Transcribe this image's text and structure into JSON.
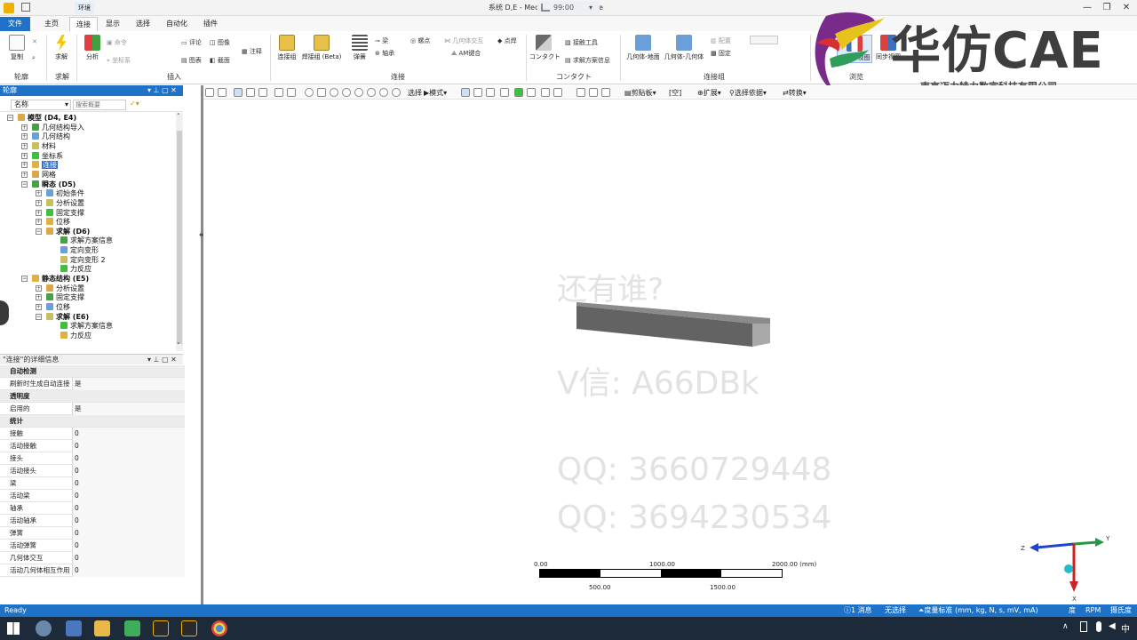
{
  "window": {
    "title": "系统 D,E - Mechanical Enterprise",
    "context_tab": "环境",
    "timer": "99:00",
    "controls": [
      "—",
      "❐",
      "✕"
    ]
  },
  "tabs": [
    "文件",
    "主页",
    "连接",
    "显示",
    "选择",
    "自动化",
    "插件"
  ],
  "ribbon": {
    "groups": {
      "outline": "轮廓",
      "solve": "求解",
      "insert": "插入",
      "connect": "连接",
      "contact": "コンタクト",
      "connect_group": "连接组",
      "browse": "浏览"
    },
    "buttons": {
      "duplicate": "复制",
      "solve": "求解",
      "analysis": "分析",
      "comment": "评论",
      "image": "图像",
      "chart": "图表",
      "section": "截面",
      "annotation": "注释",
      "connection_group": "连接组",
      "weld_group": "焊接组 (Beta)",
      "spring": "弹簧",
      "beam": "梁",
      "bearing": "轴承",
      "bolt": "螺点",
      "geometry_intersect": "几何体交互",
      "spot_weld": "点焊",
      "am_bond": "AM键合",
      "contact": "コンタクト",
      "contact_tool": "接触工具",
      "solution_info": "求解方案信息",
      "body_ground": "几何体-地面",
      "body_body": "几何体-几何体",
      "config": "配置",
      "body_views": "几何体视图",
      "sync_views": "同步视图",
      "command": "命令",
      "coordinate": "坐标系",
      "fix": "固定"
    }
  },
  "outline": {
    "header": "轮廓",
    "filter_label": "名称",
    "search_placeholder": "搜索概要",
    "tree": [
      {
        "label": "模型 (D4, E4)",
        "level": 0,
        "bold": true
      },
      {
        "label": "几何结构导入",
        "level": 1
      },
      {
        "label": "几何结构",
        "level": 1
      },
      {
        "label": "材料",
        "level": 1
      },
      {
        "label": "坐标系",
        "level": 1
      },
      {
        "label": "连接",
        "level": 1,
        "selected": true
      },
      {
        "label": "网格",
        "level": 1
      },
      {
        "label": "瞬态 (D5)",
        "level": 1,
        "bold": true
      },
      {
        "label": "初始条件",
        "level": 2
      },
      {
        "label": "分析设置",
        "level": 2
      },
      {
        "label": "固定支撑",
        "level": 2
      },
      {
        "label": "位移",
        "level": 2
      },
      {
        "label": "求解 (D6)",
        "level": 2,
        "bold": true
      },
      {
        "label": "求解方案信息",
        "level": 3
      },
      {
        "label": "定向变形",
        "level": 3
      },
      {
        "label": "定向变形 2",
        "level": 3
      },
      {
        "label": "力反应",
        "level": 3
      },
      {
        "label": "静态结构 (E5)",
        "level": 1,
        "bold": true
      },
      {
        "label": "分析设置",
        "level": 2
      },
      {
        "label": "固定支撑",
        "level": 2
      },
      {
        "label": "位移",
        "level": 2
      },
      {
        "label": "求解 (E6)",
        "level": 2,
        "bold": true
      },
      {
        "label": "求解方案信息",
        "level": 3
      },
      {
        "label": "力反应",
        "level": 3
      }
    ]
  },
  "details": {
    "header": "\"连接\"的详细信息",
    "rows": [
      {
        "section": "自动检测"
      },
      {
        "key": "刷新时生成自动连接",
        "value": "是"
      },
      {
        "section": "透明度"
      },
      {
        "key": "启用的",
        "value": "是"
      },
      {
        "section": "统计"
      },
      {
        "key": "接触",
        "value": "0"
      },
      {
        "key": "活动接触",
        "value": "0"
      },
      {
        "key": "接头",
        "value": "0"
      },
      {
        "key": "活动接头",
        "value": "0"
      },
      {
        "key": "梁",
        "value": "0"
      },
      {
        "key": "活动梁",
        "value": "0"
      },
      {
        "key": "轴承",
        "value": "0"
      },
      {
        "key": "活动轴承",
        "value": "0"
      },
      {
        "key": "弹簧",
        "value": "0"
      },
      {
        "key": "活动弹簧",
        "value": "0"
      },
      {
        "key": "几何体交互",
        "value": "0"
      },
      {
        "key": "活动几何体相互作用",
        "value": "0"
      }
    ]
  },
  "graphics_toolbar": {
    "select": "选择",
    "mode": "模式",
    "clipboard": "剪贴板",
    "empty": "[空]",
    "expand": "扩展",
    "select_by": "选择依据",
    "convert": "转换"
  },
  "viewport": {
    "watermarks": [
      "还有谁?",
      "V信: A66DBk",
      "QQ: 3660729448",
      "QQ: 3694230534"
    ],
    "scale": {
      "top_labels": [
        "0.00",
        "1000.00",
        "2000.00 (mm)"
      ],
      "bottom_labels": [
        "500.00",
        "1500.00"
      ]
    },
    "triad": {
      "x": "X",
      "y": "Y",
      "z": "Z"
    }
  },
  "status": {
    "ready": "Ready",
    "messages": "1 消息",
    "selection": "无选择",
    "units": "度量标准 (mm, kg, N, s, mV, mA)",
    "angle": "度",
    "rpm": "RPM",
    "temp": "摄氏度"
  },
  "brand": {
    "title": "华仿CAE",
    "subtitle": "南京迈力特力数字科技有限公司"
  },
  "taskbar": {
    "ime": "中",
    "tray": "∧"
  },
  "colors": {
    "accent": "#1e73c8",
    "selection": "#2b6fd4",
    "axis_x": "#cc2222",
    "axis_y": "#229944",
    "axis_z": "#2244cc"
  }
}
